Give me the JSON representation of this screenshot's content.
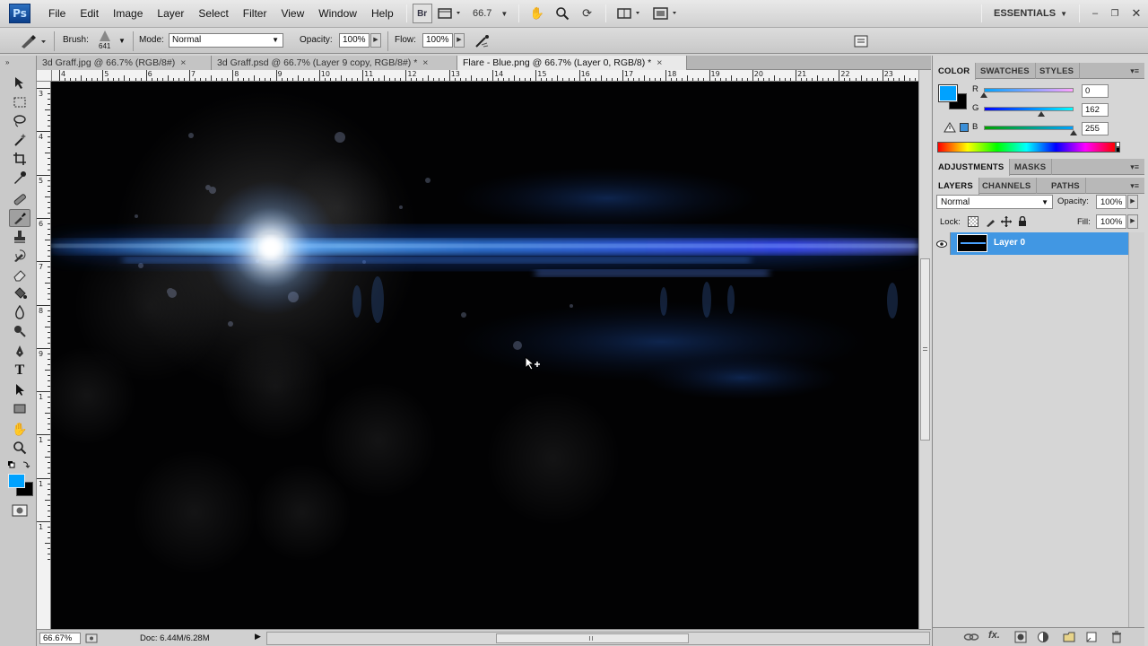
{
  "app": {
    "logo": "Ps"
  },
  "menu": [
    "File",
    "Edit",
    "Image",
    "Layer",
    "Select",
    "Filter",
    "View",
    "Window",
    "Help"
  ],
  "appbar": {
    "bridge": "Br",
    "zoom": "66.7",
    "workspace": "ESSENTIALS",
    "workspace_arrow": "▼"
  },
  "options": {
    "brush_label": "Brush:",
    "brush_size": "641",
    "mode_label": "Mode:",
    "mode_value": "Normal",
    "opacity_label": "Opacity:",
    "opacity_value": "100%",
    "flow_label": "Flow:",
    "flow_value": "100%"
  },
  "tabs": [
    {
      "title": "3d Graff.jpg @ 66.7% (RGB/8#)",
      "close": "×"
    },
    {
      "title": "3d Graff.psd @ 66.7% (Layer 9 copy, RGB/8#) *",
      "close": "×"
    },
    {
      "title": "Flare - Blue.png @ 66.7% (Layer 0, RGB/8) *",
      "close": "×"
    }
  ],
  "hruler": [
    "4",
    "5",
    "6",
    "7",
    "8",
    "9",
    "10",
    "11",
    "12",
    "13",
    "14",
    "15",
    "16",
    "17",
    "18",
    "19",
    "20",
    "21",
    "22",
    "23"
  ],
  "vruler": [
    "3",
    "4",
    "5",
    "6",
    "7",
    "8",
    "9",
    "1",
    "1",
    "1",
    "1"
  ],
  "status": {
    "zoom": "66.67%",
    "doc": "Doc: 6.44M/6.28M"
  },
  "color_panel": {
    "tabs": [
      "COLOR",
      "SWATCHES",
      "STYLES"
    ],
    "r_label": "R",
    "g_label": "G",
    "b_label": "B",
    "r": "0",
    "g": "162",
    "b": "255",
    "r_level": 0,
    "g_level": 0.635,
    "b_level": 1.0,
    "foreground": "#00a2ff",
    "background": "#000000"
  },
  "adjustments_tabs": [
    "ADJUSTMENTS",
    "MASKS"
  ],
  "layers_panel": {
    "tabs": [
      "LAYERS",
      "CHANNELS",
      "PATHS"
    ],
    "blend_mode": "Normal",
    "opacity_label": "Opacity:",
    "opacity_value": "100%",
    "lock_label": "Lock:",
    "fill_label": "Fill:",
    "fill_value": "100%",
    "layer_name": "Layer 0",
    "footer_fx": "fx."
  },
  "colors": {
    "accent": "#4197e3",
    "canvas": "#020203",
    "flare": "#3a8cff"
  }
}
